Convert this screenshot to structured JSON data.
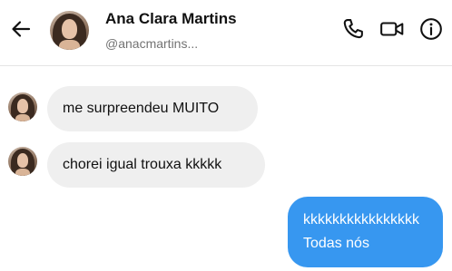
{
  "header": {
    "name": "Ana Clara Martins",
    "username": "@anacmartins...",
    "icons": {
      "back": "arrow-left-icon",
      "call": "phone-icon",
      "video": "video-camera-icon",
      "info": "info-icon"
    }
  },
  "messages": [
    {
      "direction": "incoming",
      "text": "me surpreendeu MUITO"
    },
    {
      "direction": "incoming",
      "text": "chorei igual trouxa kkkkk"
    },
    {
      "direction": "outgoing",
      "lines": [
        "kkkkkkkkkkkkkkkk",
        "Todas nós"
      ]
    }
  ],
  "colors": {
    "outgoing_bubble": "#3797f0",
    "incoming_bubble": "#efefef",
    "secondary_text": "#737373"
  }
}
